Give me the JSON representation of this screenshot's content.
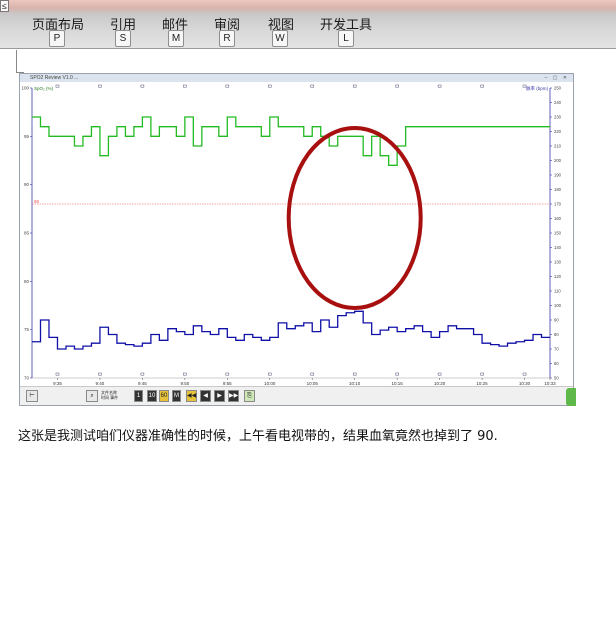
{
  "ribbon": {
    "corner": "≤",
    "tabs": [
      {
        "label": "页面布局",
        "key": "P"
      },
      {
        "label": "引用",
        "key": "S"
      },
      {
        "label": "邮件",
        "key": "M"
      },
      {
        "label": "审阅",
        "key": "R"
      },
      {
        "label": "视图",
        "key": "W"
      },
      {
        "label": "开发工具",
        "key": "L"
      }
    ]
  },
  "embedded": {
    "title": "SPO2 Review V1.0 ...",
    "controls": "– ▢ ✕",
    "left_axis_label": "SpO₂ (%)",
    "right_axis_label": "脉率 (bpm)",
    "left_ticks": [
      "100",
      "95",
      "90",
      "85",
      "80",
      "75",
      "70"
    ],
    "right_ticks": [
      "250",
      "240",
      "230",
      "220",
      "210",
      "200",
      "190",
      "180",
      "170",
      "160",
      "150",
      "140",
      "130",
      "120",
      "110",
      "100",
      "90",
      "80",
      "70",
      "60",
      "50"
    ],
    "reference_label": "88",
    "time_ticks": [
      "9:35",
      "9:40",
      "9:45",
      "9:50",
      "9:55",
      "10:00",
      "10:05",
      "10:10",
      "10:15",
      "10:20",
      "10:25",
      "10:30",
      "10:33"
    ],
    "toolbar": {
      "zoom_label_1": "文件名称",
      "zoom_label_2": "时间 事件",
      "buttons": [
        "1",
        "10",
        "60",
        "M",
        "◀◀",
        "◀",
        "▶",
        "▶▶"
      ]
    }
  },
  "caption": "这张是我测试咱们仪器准确性的时候，上午看电视带的，结果血氧竟然也掉到了 90.",
  "colors": {
    "spo2_line": "#22bb22",
    "pulse_line": "#1010a8",
    "reference_line": "#ee5555",
    "highlight_ellipse": "#a81010",
    "axis": "#3a3aa8"
  },
  "chart_data": {
    "type": "line",
    "x_range": [
      "9:32",
      "10:33"
    ],
    "series": [
      {
        "axis": "left",
        "x": [
          "9:32",
          "9:33",
          "9:34",
          "9:35",
          "9:36",
          "9:37",
          "9:38",
          "9:39",
          "9:40",
          "9:41",
          "9:42",
          "9:43",
          "9:44",
          "9:45",
          "9:46",
          "9:47",
          "9:48",
          "9:49",
          "9:50",
          "9:51",
          "9:52",
          "9:53",
          "9:54",
          "9:55",
          "9:56",
          "9:57",
          "9:58",
          "9:59",
          "10:00",
          "10:01",
          "10:02",
          "10:03",
          "10:04",
          "10:05",
          "10:06",
          "10:07",
          "10:08",
          "10:09",
          "10:10",
          "10:11",
          "10:12",
          "10:13",
          "10:14",
          "10:15",
          "10:16",
          "10:17",
          "10:18",
          "10:19",
          "10:20",
          "10:21",
          "10:22",
          "10:23",
          "10:24",
          "10:25",
          "10:26",
          "10:27",
          "10:28",
          "10:29",
          "10:30",
          "10:31",
          "10:32",
          "10:33"
        ],
        "values": [
          97,
          96,
          95,
          95,
          95,
          94,
          95,
          96,
          93,
          95,
          96,
          95,
          96,
          97,
          95,
          96,
          96,
          95,
          97,
          94,
          96,
          96,
          95,
          97,
          96,
          96,
          96,
          95,
          97,
          96,
          96,
          96,
          95,
          96,
          95,
          94,
          95,
          95,
          95,
          93,
          95,
          93,
          92,
          94,
          96,
          96,
          96,
          96,
          96,
          96,
          96,
          96,
          96,
          96,
          96,
          96,
          96,
          96,
          96,
          96,
          96,
          96
        ]
      },
      {
        "axis": "right",
        "x": [
          "9:32",
          "9:33",
          "9:34",
          "9:35",
          "9:36",
          "9:37",
          "9:38",
          "9:39",
          "9:40",
          "9:41",
          "9:42",
          "9:43",
          "9:44",
          "9:45",
          "9:46",
          "9:47",
          "9:48",
          "9:49",
          "9:50",
          "9:51",
          "9:52",
          "9:53",
          "9:54",
          "9:55",
          "9:56",
          "9:57",
          "9:58",
          "9:59",
          "10:00",
          "10:01",
          "10:02",
          "10:03",
          "10:04",
          "10:05",
          "10:06",
          "10:07",
          "10:08",
          "10:09",
          "10:10",
          "10:11",
          "10:12",
          "10:13",
          "10:14",
          "10:15",
          "10:16",
          "10:17",
          "10:18",
          "10:19",
          "10:20",
          "10:21",
          "10:22",
          "10:23",
          "10:24",
          "10:25",
          "10:26",
          "10:27",
          "10:28",
          "10:29",
          "10:30",
          "10:31",
          "10:32",
          "10:33"
        ],
        "values": [
          75,
          90,
          78,
          70,
          72,
          70,
          72,
          74,
          85,
          80,
          74,
          73,
          72,
          74,
          80,
          76,
          84,
          82,
          80,
          86,
          82,
          80,
          84,
          78,
          76,
          80,
          78,
          76,
          78,
          88,
          84,
          86,
          88,
          82,
          90,
          85,
          93,
          95,
          96,
          88,
          80,
          83,
          85,
          82,
          84,
          86,
          82,
          78,
          82,
          86,
          84,
          84,
          80,
          74,
          73,
          72,
          74,
          75,
          76,
          80,
          78,
          78
        ]
      }
    ],
    "ylim_left": [
      70,
      100
    ],
    "ylim_right": [
      50,
      250
    ],
    "reference_line_left": 88
  }
}
